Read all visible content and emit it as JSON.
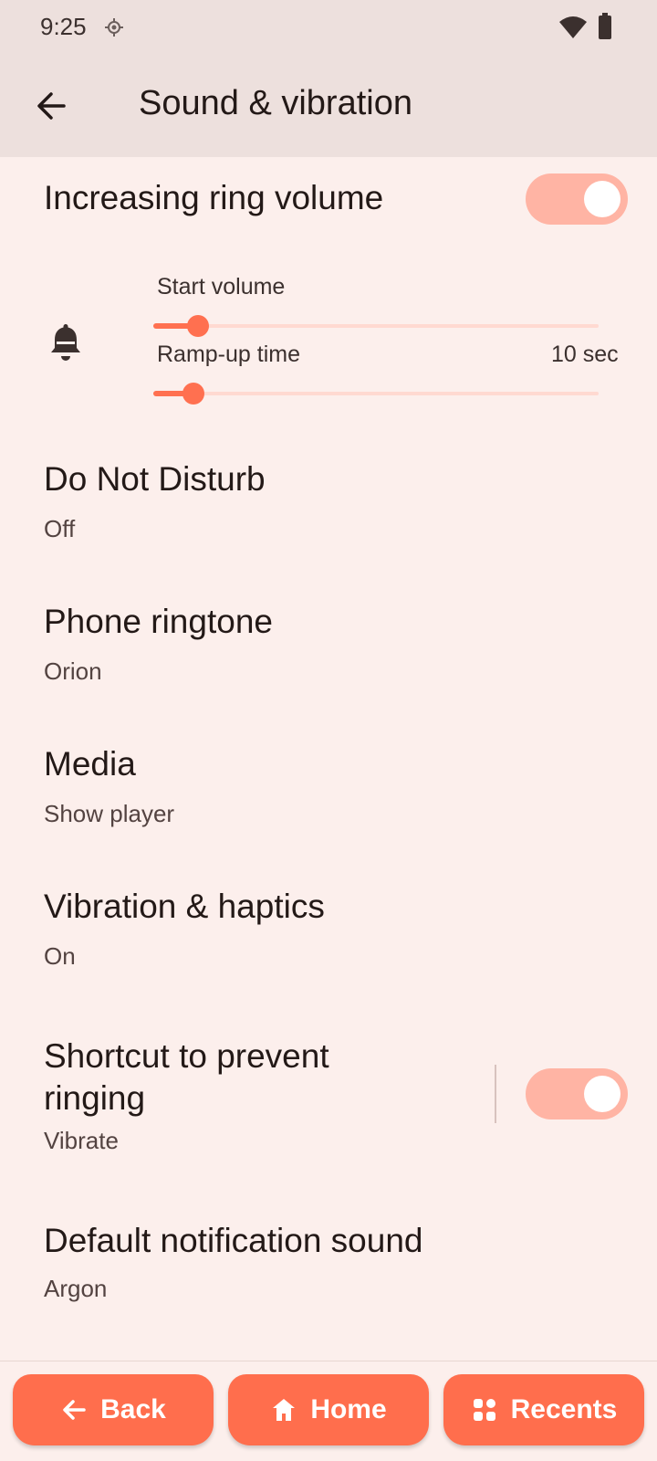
{
  "status_bar": {
    "time": "9:25"
  },
  "app_bar": {
    "title": "Sound & vibration"
  },
  "increasing_ring": {
    "label": "Increasing ring volume",
    "enabled": true
  },
  "start_volume": {
    "label": "Start volume",
    "value": 0.1
  },
  "ramp_up": {
    "label": "Ramp-up time",
    "value_text": "10 sec",
    "value": 0.09
  },
  "rows": [
    {
      "title": "Do Not Disturb",
      "subtitle": "Off"
    },
    {
      "title": "Phone ringtone",
      "subtitle": "Orion"
    },
    {
      "title": "Media",
      "subtitle": "Show player"
    },
    {
      "title": "Vibration & haptics",
      "subtitle": "On"
    }
  ],
  "shortcut": {
    "title_line1": "Shortcut to prevent",
    "title_line2": "ringing",
    "subtitle": "Vibrate",
    "enabled": true
  },
  "default_notification": {
    "title": "Default notification sound",
    "subtitle": "Argon"
  },
  "nav": {
    "back": "Back",
    "home": "Home",
    "recents": "Recents"
  },
  "colors": {
    "accent": "#ff6e4d",
    "toggle_track": "#ffb4a4",
    "background": "#fcefec",
    "bar": "#ede0dd"
  }
}
